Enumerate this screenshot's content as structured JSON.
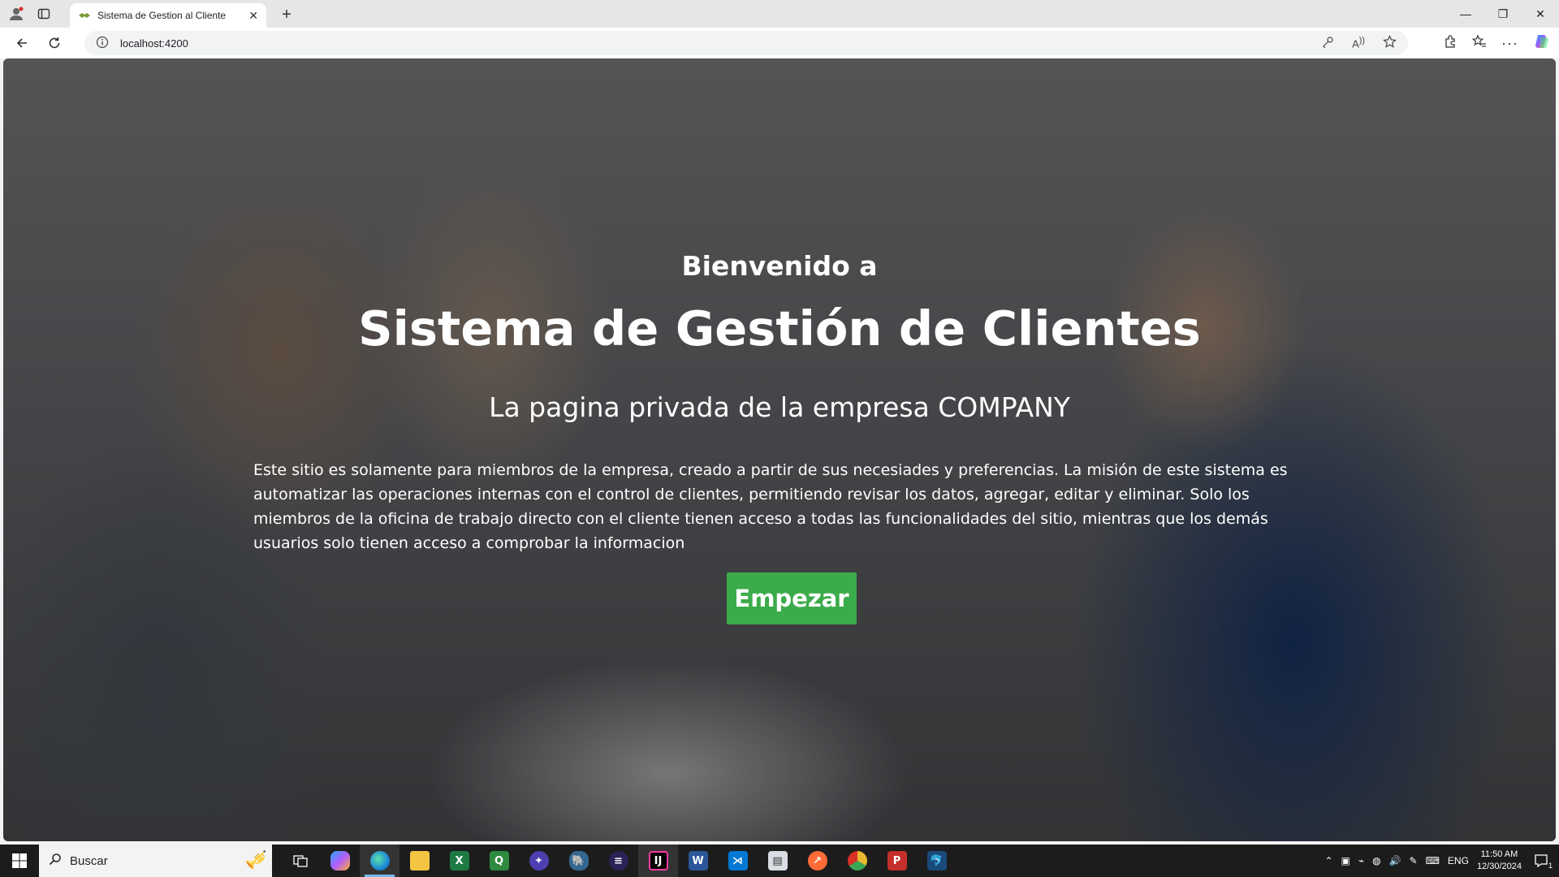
{
  "browser": {
    "tab_title": "Sistema de Gestion al Cliente",
    "url": "localhost:4200"
  },
  "hero": {
    "greeting": "Bienvenido a",
    "title": "Sistema de Gestión de Clientes",
    "subtitle": "La pagina privada de la empresa COMPANY",
    "description": "Este sitio es solamente para miembros de la empresa, creado a partir de sus necesiades y preferencias. La misión de este sistema es automatizar las operaciones internas con el control de clientes, permitiendo revisar los datos, agregar, editar y eliminar. Solo los miembros de la oficina de trabajo directo con el cliente tienen acceso a todas las funcionalidades del sitio, mientras que los demás usuarios solo tienen acceso a comprobar la informacion",
    "cta_label": "Empezar"
  },
  "colors": {
    "cta": "#3cab4b",
    "taskbar": "#1c1c1c"
  },
  "taskbar": {
    "search_placeholder": "Buscar",
    "language": "ENG",
    "time": "11:50 AM",
    "date": "12/30/2024",
    "notification_count": "1",
    "apps": [
      "task-view",
      "copilot",
      "edge",
      "file-explorer",
      "excel",
      "qlik",
      "eclipse",
      "postgres",
      "eclipse-ide",
      "intellij",
      "word",
      "vscode",
      "notepad",
      "postman",
      "chrome-canary",
      "powerpoint-p",
      "mysql-workbench"
    ]
  }
}
